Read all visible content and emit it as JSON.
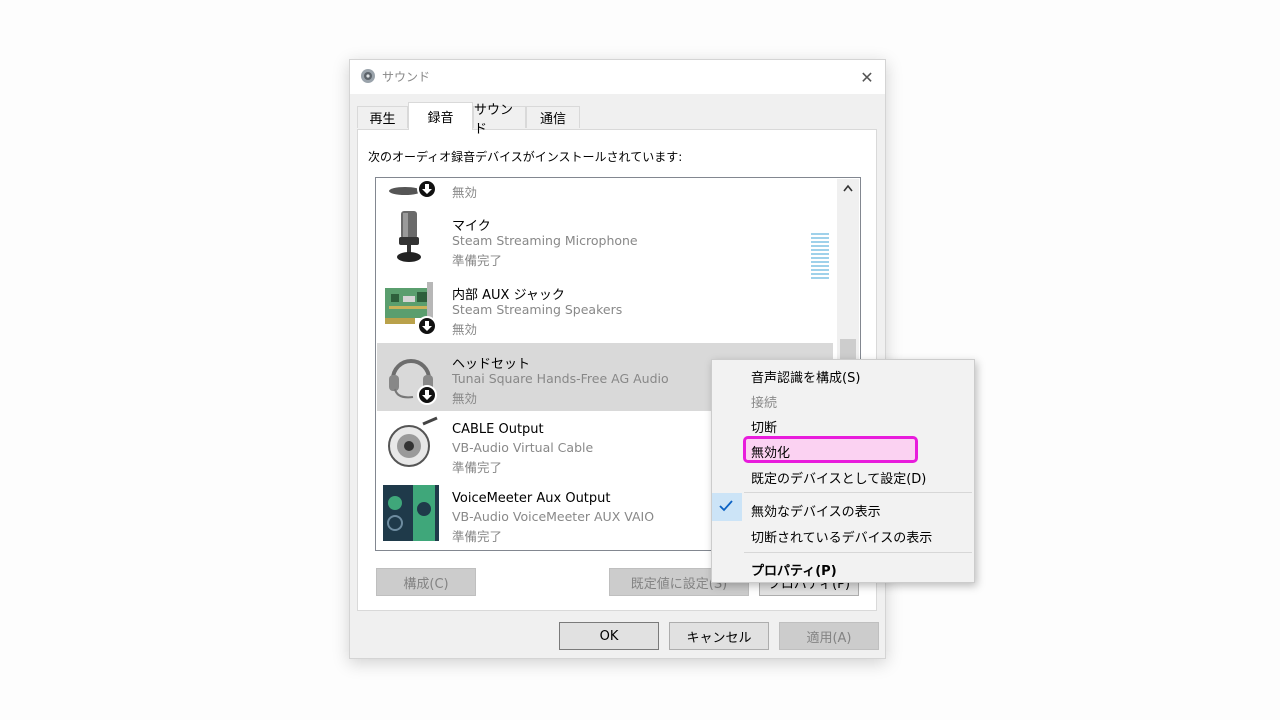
{
  "window": {
    "title": "サウンド",
    "close_glyph": "✕"
  },
  "tabs": [
    {
      "label": "再生",
      "active": false
    },
    {
      "label": "録音",
      "active": true
    },
    {
      "label": "サウンド",
      "active": false
    },
    {
      "label": "通信",
      "active": false
    }
  ],
  "instruction": "次のオーディオ録音デバイスがインストールされています:",
  "devices": [
    {
      "name": "",
      "description": "",
      "status": "無効",
      "icon": "microphone-icon",
      "disabled_badge": true
    },
    {
      "name": "マイク",
      "description": "Steam Streaming Microphone",
      "status": "準備完了",
      "icon": "microphone-icon",
      "disabled_badge": false,
      "has_level_meter": true
    },
    {
      "name": "内部 AUX ジャック",
      "description": "Steam Streaming Speakers",
      "status": "無効",
      "icon": "sound-card-icon",
      "disabled_badge": true
    },
    {
      "name": "ヘッドセット",
      "description": "Tunai Square Hands-Free AG Audio",
      "status": "無効",
      "icon": "headset-icon",
      "disabled_badge": true,
      "selected": true
    },
    {
      "name": "CABLE Output",
      "description": "VB-Audio Virtual Cable",
      "status": "準備完了",
      "icon": "cable-icon",
      "disabled_badge": false
    },
    {
      "name": "VoiceMeeter Aux Output",
      "description": "VB-Audio VoiceMeeter AUX VAIO",
      "status": "準備完了",
      "icon": "voicemeeter-icon",
      "disabled_badge": false
    }
  ],
  "buttons": {
    "configure": "構成(C)",
    "set_default": "既定値に設定(S)",
    "properties": "プロパティ(P)",
    "ok": "OK",
    "cancel": "キャンセル",
    "apply": "適用(A)"
  },
  "context_menu": [
    {
      "label": "音声認識を構成(S)",
      "disabled": false
    },
    {
      "label": "接続",
      "disabled": true
    },
    {
      "label": "切断",
      "disabled": false
    },
    {
      "label": "無効化",
      "disabled": false,
      "highlighted": true
    },
    {
      "label": "既定のデバイスとして設定(D)",
      "disabled": false
    },
    {
      "label": "無効なデバイスの表示",
      "checked": true
    },
    {
      "label": "切断されているデバイスの表示",
      "checked": false
    },
    {
      "label": "プロパティ(P)",
      "bold": true
    }
  ],
  "colors": {
    "highlight_border": "#e81cdc",
    "highlight_fill": "#fbd2f2",
    "selected_row": "#d9d9d9",
    "level_meter": "#9fd1ea"
  }
}
